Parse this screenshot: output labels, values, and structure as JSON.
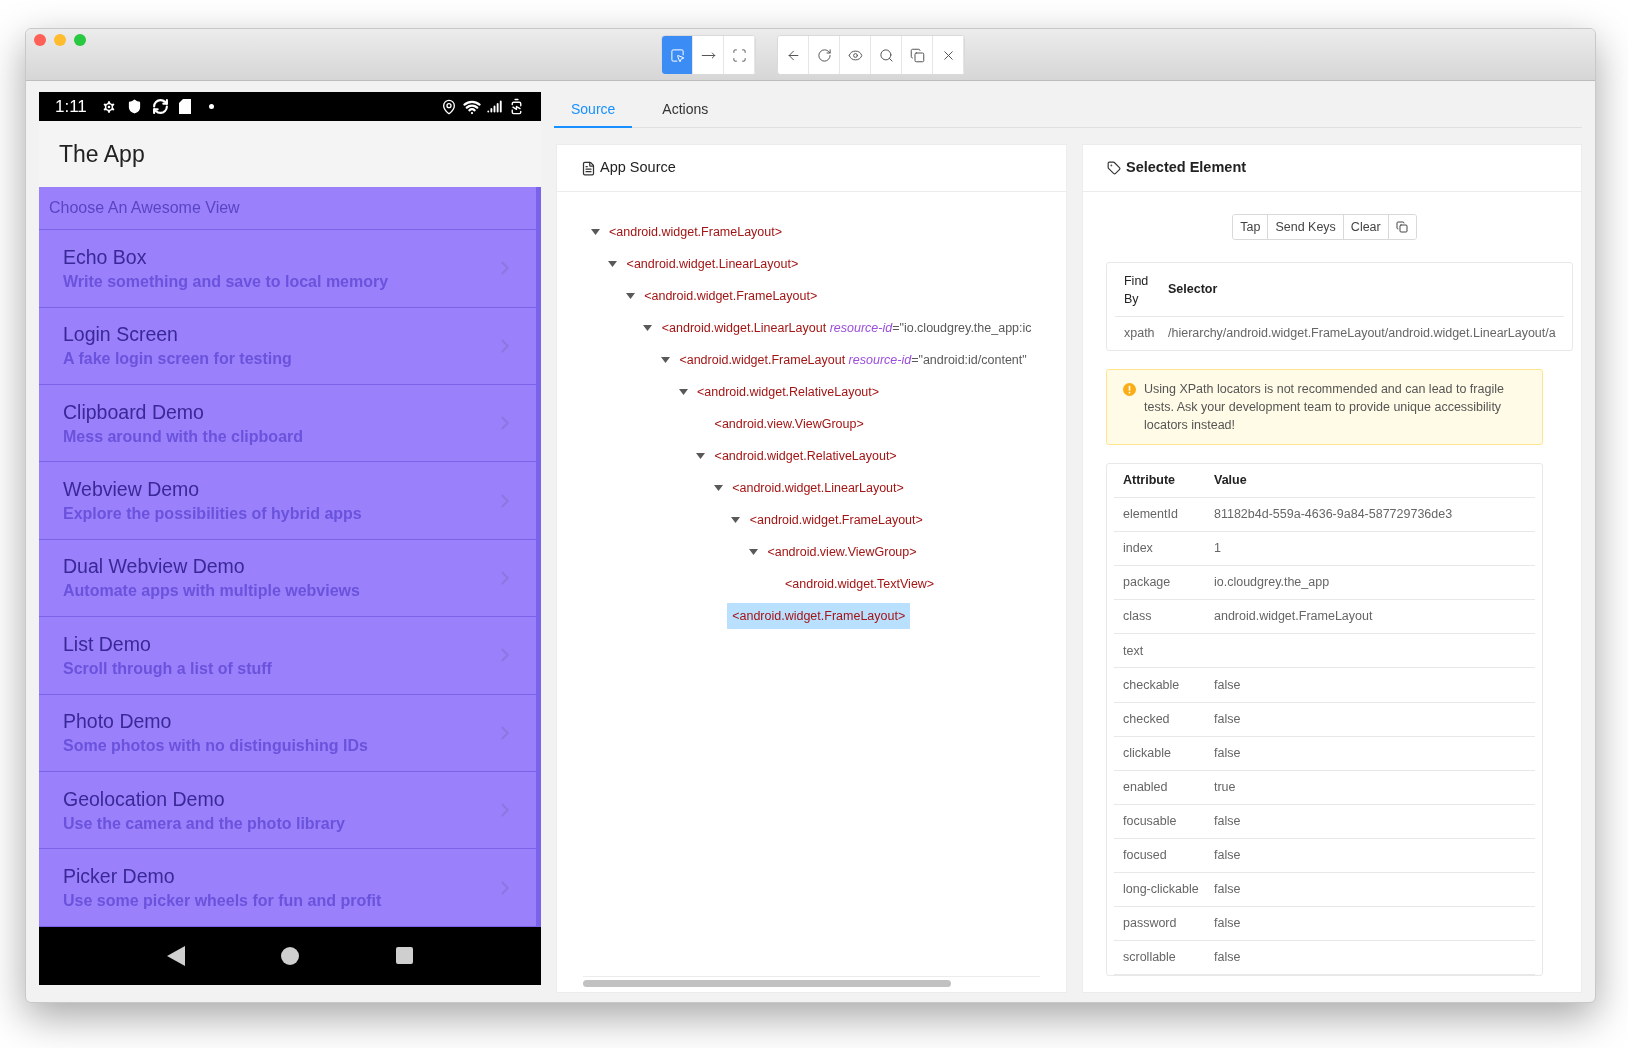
{
  "toolbar": {
    "mode_buttons": [
      {
        "kind": "select",
        "selected": true
      },
      {
        "kind": "swipe",
        "selected": false
      },
      {
        "kind": "fullscreen",
        "selected": false
      }
    ],
    "action_buttons": [
      {
        "kind": "back"
      },
      {
        "kind": "refresh"
      },
      {
        "kind": "eye"
      },
      {
        "kind": "search"
      },
      {
        "kind": "copy"
      },
      {
        "kind": "close"
      }
    ]
  },
  "phone": {
    "status_bar": {
      "time": "1:11"
    },
    "app_title": "The App",
    "list_header": "Choose An Awesome View",
    "items": [
      {
        "title": "Echo Box",
        "subtitle": "Write something and save to local memory"
      },
      {
        "title": "Login Screen",
        "subtitle": "A fake login screen for testing"
      },
      {
        "title": "Clipboard Demo",
        "subtitle": "Mess around with the clipboard"
      },
      {
        "title": "Webview Demo",
        "subtitle": "Explore the possibilities of hybrid apps"
      },
      {
        "title": "Dual Webview Demo",
        "subtitle": "Automate apps with multiple webviews"
      },
      {
        "title": "List Demo",
        "subtitle": "Scroll through a list of stuff"
      },
      {
        "title": "Photo Demo",
        "subtitle": "Some photos with no distinguishing IDs"
      },
      {
        "title": "Geolocation Demo",
        "subtitle": "Use the camera and the photo library"
      },
      {
        "title": "Picker Demo",
        "subtitle": "Use some picker wheels for fun and profit"
      }
    ]
  },
  "tabs": [
    {
      "label": "Source",
      "selected": true
    },
    {
      "label": "Actions",
      "selected": false
    }
  ],
  "source_panel": {
    "title": "App Source",
    "tree": [
      {
        "tag": "<android.widget.FrameLayout>",
        "expanded": true,
        "selected": false,
        "children": [
          {
            "tag": "<android.widget.LinearLayout>",
            "expanded": true,
            "selected": false,
            "children": [
              {
                "tag": "<android.widget.FrameLayout>",
                "expanded": true,
                "selected": false,
                "children": [
                  {
                    "tag": "<android.widget.LinearLayout",
                    "attr_name": "resource-id",
                    "attr_value": "=\"io.cloudgrey.the_app:ic",
                    "expanded": true,
                    "selected": false,
                    "children": [
                      {
                        "tag": "<android.widget.FrameLayout",
                        "attr_name": "resource-id",
                        "attr_value": "=\"android:id/content\"",
                        "expanded": true,
                        "selected": false,
                        "children": [
                          {
                            "tag": "<android.widget.RelativeLayout>",
                            "expanded": true,
                            "selected": false,
                            "children": [
                              {
                                "tag": "<android.view.ViewGroup>",
                                "selected": false
                              },
                              {
                                "tag": "<android.widget.RelativeLayout>",
                                "expanded": true,
                                "selected": false,
                                "children": [
                                  {
                                    "tag": "<android.widget.LinearLayout>",
                                    "expanded": true,
                                    "selected": false,
                                    "children": [
                                      {
                                        "tag": "<android.widget.FrameLayout>",
                                        "expanded": true,
                                        "selected": false,
                                        "children": [
                                          {
                                            "tag": "<android.view.ViewGroup>",
                                            "expanded": true,
                                            "selected": false,
                                            "children": [
                                              {
                                                "tag": "<android.widget.TextView>",
                                                "selected": false
                                              }
                                            ]
                                          }
                                        ]
                                      }
                                    ]
                                  },
                                  {
                                    "tag": "<android.widget.FrameLayout>",
                                    "selected": true
                                  }
                                ]
                              }
                            ]
                          }
                        ]
                      }
                    ]
                  }
                ]
              }
            ]
          }
        ]
      }
    ]
  },
  "selected_panel": {
    "title": "Selected Element",
    "buttons": [
      "Tap",
      "Send Keys",
      "Clear"
    ],
    "selectors": {
      "columns": [
        "Find By",
        "Selector"
      ],
      "rows": [
        {
          "find_by": "xpath",
          "selector": "/hierarchy/android.widget.FrameLayout/android.widget.LinearLayout/a"
        }
      ]
    },
    "warning": "Using XPath locators is not recommended and can lead to fragile tests. Ask your development team to provide unique accessibility locators instead!",
    "attributes": {
      "columns": [
        "Attribute",
        "Value"
      ],
      "rows": [
        {
          "name": "elementId",
          "value": "81182b4d-559a-4636-9a84-587729736de3"
        },
        {
          "name": "index",
          "value": "1"
        },
        {
          "name": "package",
          "value": "io.cloudgrey.the_app"
        },
        {
          "name": "class",
          "value": "android.widget.FrameLayout"
        },
        {
          "name": "text"
        },
        {
          "name": "checkable",
          "value": "false"
        },
        {
          "name": "checked",
          "value": "false"
        },
        {
          "name": "clickable",
          "value": "false"
        },
        {
          "name": "enabled",
          "value": "true"
        },
        {
          "name": "focusable",
          "value": "false"
        },
        {
          "name": "focused",
          "value": "false"
        },
        {
          "name": "long-clickable",
          "value": "false"
        },
        {
          "name": "password",
          "value": "false"
        },
        {
          "name": "scrollable",
          "value": "false"
        }
      ]
    }
  }
}
